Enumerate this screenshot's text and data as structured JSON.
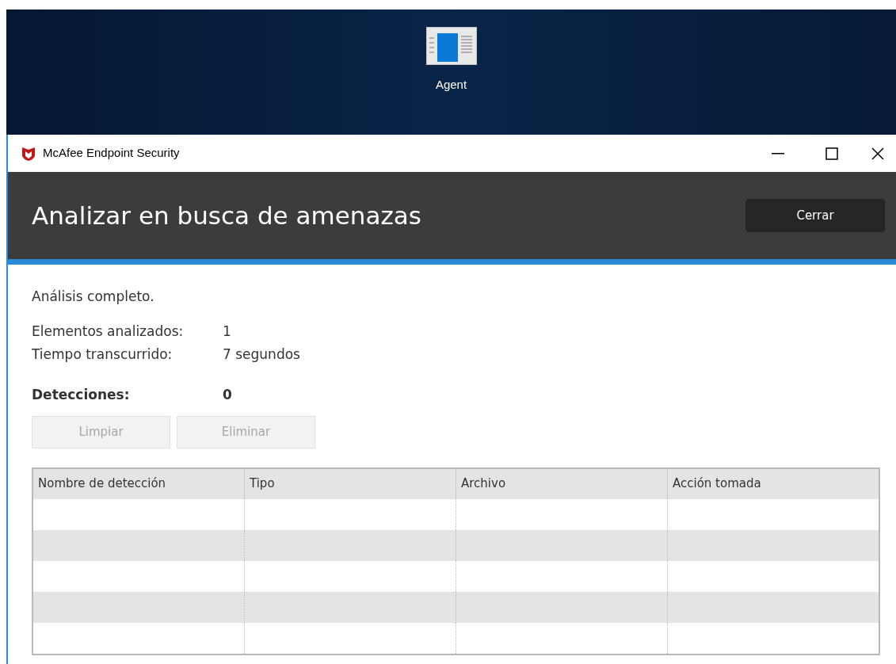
{
  "desktop": {
    "icons": [
      {
        "label": "Agent"
      }
    ]
  },
  "window": {
    "title": "McAfee Endpoint Security"
  },
  "header": {
    "title": "Analizar en busca de amenazas",
    "button": "Cerrar"
  },
  "status": "Análisis completo.",
  "stats": [
    {
      "label": "Elementos analizados:",
      "value": "1",
      "bold": false
    },
    {
      "label": "Tiempo transcurrido:",
      "value": "7 segundos",
      "bold": false
    },
    {
      "label": "Detecciones:",
      "value": "0",
      "bold": true
    }
  ],
  "actions": [
    {
      "label": "Limpiar",
      "disabled": true
    },
    {
      "label": "Eliminar",
      "disabled": true
    }
  ],
  "table": {
    "columns": [
      "Nombre de detección",
      "Tipo",
      "Archivo",
      "Acción tomada"
    ]
  }
}
